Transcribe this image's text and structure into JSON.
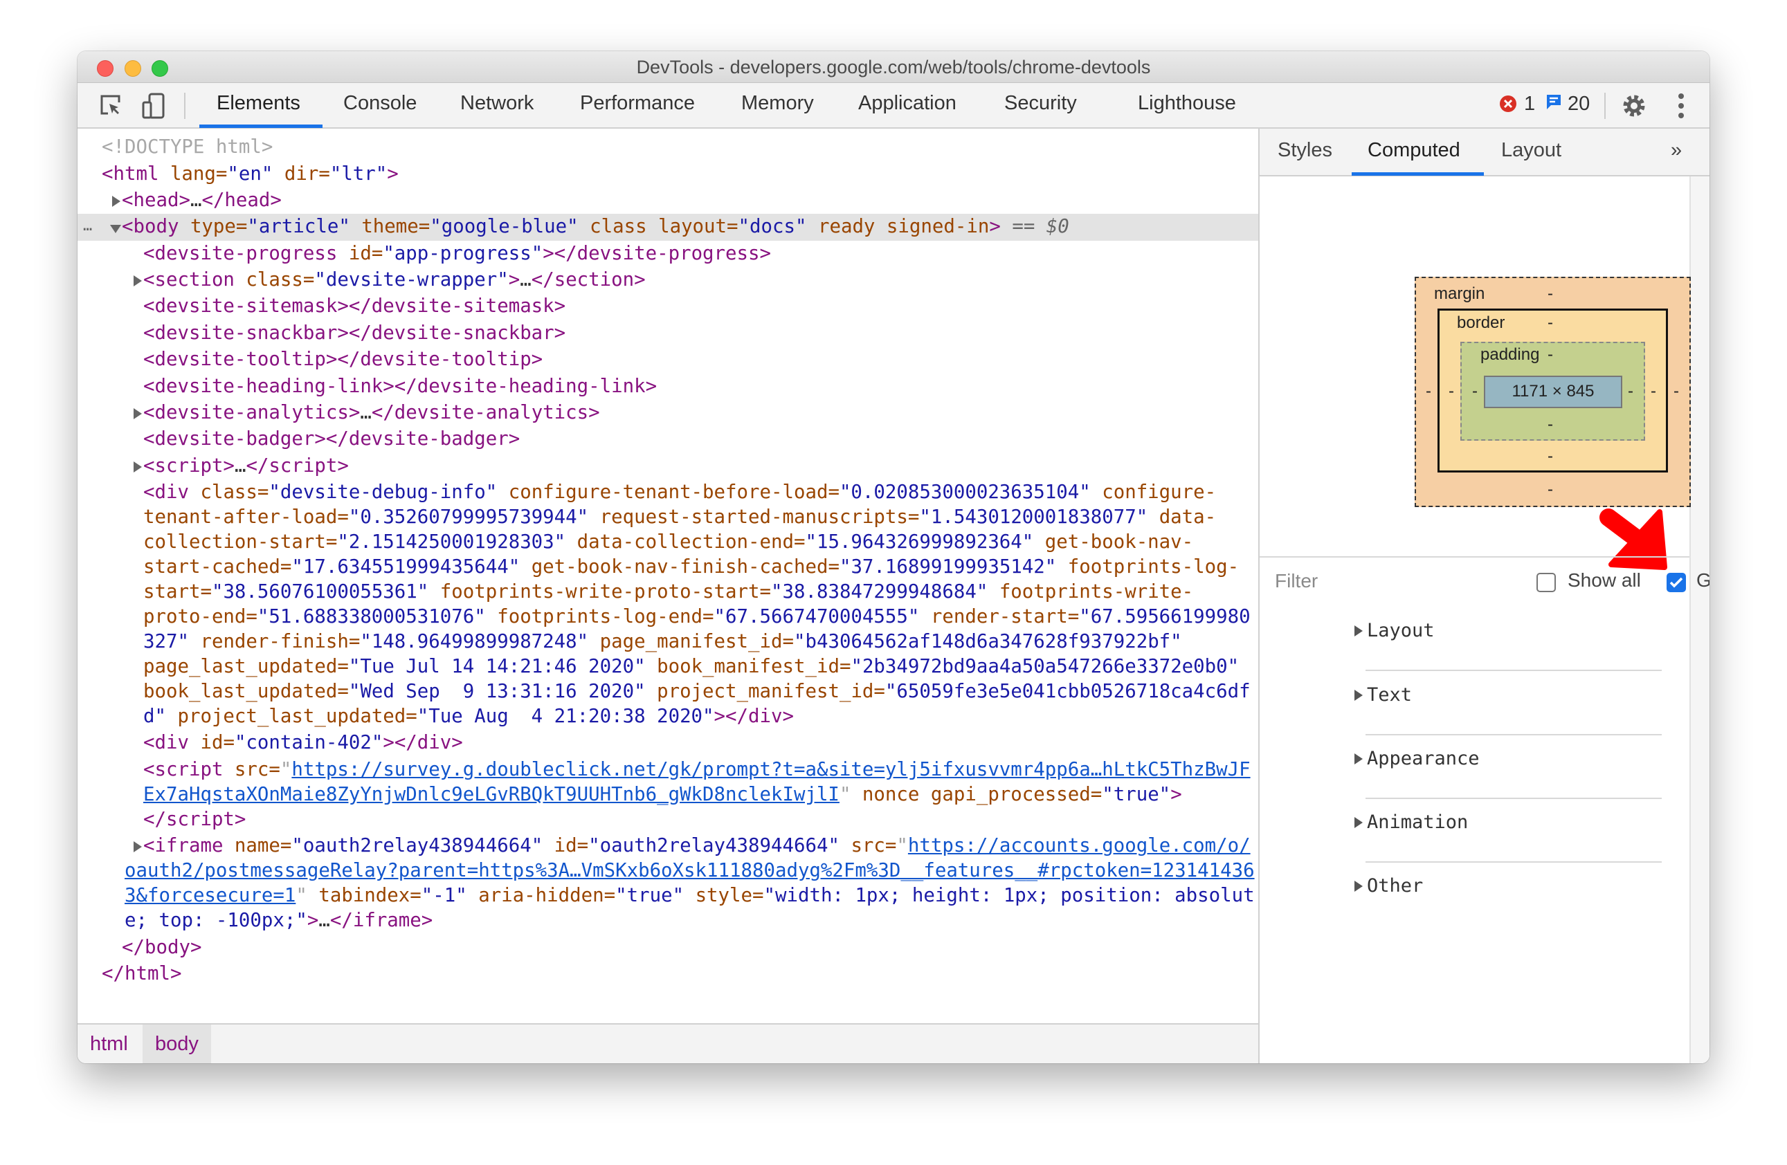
{
  "window": {
    "title": "DevTools - developers.google.com/web/tools/chrome-devtools"
  },
  "toolbar": {
    "tabs": [
      {
        "label": "Elements",
        "active": true
      },
      {
        "label": "Console"
      },
      {
        "label": "Network"
      },
      {
        "label": "Performance"
      },
      {
        "label": "Memory"
      },
      {
        "label": "Application"
      },
      {
        "label": "Security"
      },
      {
        "label": "Lighthouse"
      }
    ],
    "error_count": "1",
    "message_count": "20",
    "colors": {
      "accent": "#1a73e8",
      "error": "#d93025"
    }
  },
  "elements_panel": {
    "nodes": [
      {
        "depth": 0,
        "lines": [
          [
            [
              "d",
              "<!DOCTYPE html>"
            ]
          ]
        ]
      },
      {
        "depth": 0,
        "lines": [
          [
            [
              "t",
              "<html"
            ],
            [
              "a",
              " lang="
            ],
            [
              "v",
              "\"en\""
            ],
            [
              "a",
              " dir="
            ],
            [
              "v",
              "\"ltr\""
            ],
            [
              "t",
              ">"
            ]
          ]
        ]
      },
      {
        "depth": 1,
        "expander": "collapsed",
        "lines": [
          [
            [
              "t",
              "<head>"
            ],
            [
              "x",
              "…"
            ],
            [
              "t",
              "</head>"
            ]
          ]
        ]
      },
      {
        "depth": 1,
        "expander": "expanded",
        "selected": true,
        "lines": [
          [
            [
              "t",
              "<body"
            ],
            [
              "a",
              " type="
            ],
            [
              "v",
              "\"article\""
            ],
            [
              "a",
              " theme="
            ],
            [
              "v",
              "\"google-blue\""
            ],
            [
              "a",
              " class layout="
            ],
            [
              "v",
              "\"docs\""
            ],
            [
              "a",
              " ready signed-in"
            ],
            [
              "t",
              ">"
            ],
            [
              "o",
              " == $0"
            ]
          ]
        ]
      },
      {
        "depth": 2,
        "lines": [
          [
            [
              "t",
              "<devsite-progress"
            ],
            [
              "a",
              " id="
            ],
            [
              "v",
              "\"app-progress\""
            ],
            [
              "t",
              "></devsite-progress>"
            ]
          ]
        ]
      },
      {
        "depth": 2,
        "expander": "collapsed",
        "lines": [
          [
            [
              "t",
              "<section"
            ],
            [
              "a",
              " class="
            ],
            [
              "v",
              "\"devsite-wrapper\""
            ],
            [
              "t",
              ">"
            ],
            [
              "x",
              "…"
            ],
            [
              "t",
              "</section>"
            ]
          ]
        ]
      },
      {
        "depth": 2,
        "lines": [
          [
            [
              "t",
              "<devsite-sitemask></devsite-sitemask>"
            ]
          ]
        ]
      },
      {
        "depth": 2,
        "lines": [
          [
            [
              "t",
              "<devsite-snackbar></devsite-snackbar>"
            ]
          ]
        ]
      },
      {
        "depth": 2,
        "lines": [
          [
            [
              "t",
              "<devsite-tooltip></devsite-tooltip>"
            ]
          ]
        ]
      },
      {
        "depth": 2,
        "lines": [
          [
            [
              "t",
              "<devsite-heading-link></devsite-heading-link>"
            ]
          ]
        ]
      },
      {
        "depth": 2,
        "expander": "collapsed",
        "lines": [
          [
            [
              "t",
              "<devsite-analytics>"
            ],
            [
              "x",
              "…"
            ],
            [
              "t",
              "</devsite-analytics>"
            ]
          ]
        ]
      },
      {
        "depth": 2,
        "lines": [
          [
            [
              "t",
              "<devsite-badger></devsite-badger>"
            ]
          ]
        ]
      },
      {
        "depth": 2,
        "expander": "collapsed",
        "lines": [
          [
            [
              "t",
              "<script>"
            ],
            [
              "x",
              "…"
            ],
            [
              "t",
              "</script>"
            ]
          ]
        ]
      },
      {
        "depth": 2,
        "lines": [
          [
            [
              "t",
              "<div"
            ],
            [
              "a",
              " class="
            ],
            [
              "v",
              "\"devsite-debug-info\""
            ],
            [
              "a",
              " configure-tenant-before-load="
            ],
            [
              "v",
              "\"0.020853000023635104\""
            ],
            [
              "a",
              " configure-"
            ]
          ],
          [
            [
              "a",
              "tenant-after-load="
            ],
            [
              "v",
              "\"0.35260799995739944\""
            ],
            [
              "a",
              " request-started-manuscripts="
            ],
            [
              "v",
              "\"1.5430120001838077\""
            ],
            [
              "a",
              " data-"
            ]
          ],
          [
            [
              "a",
              "collection-start="
            ],
            [
              "v",
              "\"2.1514250001928303\""
            ],
            [
              "a",
              " data-collection-end="
            ],
            [
              "v",
              "\"15.964326999892364\""
            ],
            [
              "a",
              " get-book-nav-"
            ]
          ],
          [
            [
              "a",
              "start-cached="
            ],
            [
              "v",
              "\"17.634551999435644\""
            ],
            [
              "a",
              " get-book-nav-finish-cached="
            ],
            [
              "v",
              "\"37.16899199935142\""
            ],
            [
              "a",
              " footprints-log-"
            ]
          ],
          [
            [
              "a",
              "start="
            ],
            [
              "v",
              "\"38.56076100055361\""
            ],
            [
              "a",
              " footprints-write-proto-start="
            ],
            [
              "v",
              "\"38.83847299948684\""
            ],
            [
              "a",
              " footprints-write-"
            ]
          ],
          [
            [
              "a",
              "proto-end="
            ],
            [
              "v",
              "\"51.688338000531076\""
            ],
            [
              "a",
              " footprints-log-end="
            ],
            [
              "v",
              "\"67.5667470004555\""
            ],
            [
              "a",
              " render-start="
            ],
            [
              "v",
              "\"67.59566199980"
            ]
          ],
          [
            [
              "v",
              "327\""
            ],
            [
              "a",
              " render-finish="
            ],
            [
              "v",
              "\"148.96499899987248\""
            ],
            [
              "a",
              " page_manifest_id="
            ],
            [
              "v",
              "\"b43064562af148d6a347628f937922bf\""
            ]
          ],
          [
            [
              "a",
              "page_last_updated="
            ],
            [
              "v",
              "\"Tue Jul 14 14:21:46 2020\""
            ],
            [
              "a",
              " book_manifest_id="
            ],
            [
              "v",
              "\"2b34972bd9aa4a50a547266e3372e0b0\""
            ]
          ],
          [
            [
              "a",
              "book_last_updated="
            ],
            [
              "v",
              "\"Wed Sep  9 13:31:16 2020\""
            ],
            [
              "a",
              " project_manifest_id="
            ],
            [
              "v",
              "\"65059fe3e5e041cbb0526718ca4c6df"
            ]
          ],
          [
            [
              "v",
              "d\""
            ],
            [
              "a",
              " project_last_updated="
            ],
            [
              "v",
              "\"Tue Aug  4 21:20:38 2020\""
            ],
            [
              "t",
              "></div>"
            ]
          ]
        ]
      },
      {
        "depth": 2,
        "lines": [
          [
            [
              "t",
              "<div"
            ],
            [
              "a",
              " id="
            ],
            [
              "v",
              "\"contain-402\""
            ],
            [
              "t",
              "></div>"
            ]
          ]
        ]
      },
      {
        "depth": 2,
        "lines": [
          [
            [
              "t",
              "<script"
            ],
            [
              "a",
              " src="
            ],
            [
              "p",
              "\""
            ],
            [
              "l",
              "https://survey.g.doubleclick.net/gk/prompt?t=a&site=ylj5ifxusvvmr4pp6a…hLtkC5ThzBwJF"
            ]
          ],
          [
            [
              "l",
              "Ex7aHqstaXOnMaie8ZyYnjwDnlc9eLGvRBQkT9UUHTnb6_gWkD8nclekIwjlI"
            ],
            [
              "p",
              "\""
            ],
            [
              "a",
              " nonce gapi_processed="
            ],
            [
              "v",
              "\"true\""
            ],
            [
              "t",
              ">"
            ]
          ],
          [
            [
              "t",
              "</script>"
            ]
          ]
        ]
      },
      {
        "depth": 2,
        "expander": "collapsed",
        "lines": [
          [
            [
              "t",
              "<iframe"
            ],
            [
              "a",
              " name="
            ],
            [
              "v",
              "\"oauth2relay438944664\""
            ],
            [
              "a",
              " id="
            ],
            [
              "v",
              "\"oauth2relay438944664\""
            ],
            [
              "a",
              " src="
            ],
            [
              "p",
              "\""
            ],
            [
              "l",
              "https://accounts.google.com/o/"
            ]
          ],
          [
            [
              "l",
              "oauth2/postmessageRelay?parent=https%3A…VmSKxb6oXsk111880adyg%2Fm%3D__features__#rpctoken=123141436"
            ]
          ],
          [
            [
              "l",
              "3&forcesecure=1"
            ],
            [
              "p",
              "\""
            ],
            [
              "a",
              " tabindex="
            ],
            [
              "v",
              "\"-1\""
            ],
            [
              "a",
              " aria-hidden="
            ],
            [
              "v",
              "\"true\""
            ],
            [
              "a",
              " style="
            ],
            [
              "v",
              "\"width: 1px; height: 1px; position: absolut"
            ]
          ],
          [
            [
              "v",
              "e; top: -100px;\""
            ],
            [
              "t",
              ">"
            ],
            [
              "x",
              "…"
            ],
            [
              "t",
              "</iframe>"
            ]
          ]
        ]
      },
      {
        "depth": 1,
        "lines": [
          [
            [
              "t",
              "</body>"
            ]
          ]
        ]
      },
      {
        "depth": 0,
        "lines": [
          [
            [
              "t",
              "</html>"
            ]
          ]
        ]
      }
    ],
    "selected_marker": "…"
  },
  "breadcrumbs": [
    "html",
    "body"
  ],
  "sidebar": {
    "tabs": [
      {
        "label": "Styles"
      },
      {
        "label": "Computed",
        "active": true
      },
      {
        "label": "Layout"
      }
    ],
    "overflow_label": "»",
    "box_model": {
      "margin_label": "margin",
      "margin_top": "-",
      "margin_right": "-",
      "margin_bottom": "-",
      "margin_left": "-",
      "border_label": "border",
      "border_top": "-",
      "border_right": "-",
      "border_bottom": "-",
      "border_left": "-",
      "padding_label": "padding",
      "padding_top": "-",
      "padding_right": "-",
      "padding_bottom": "-",
      "padding_left": "-",
      "content_size": "1171 × 845",
      "colors": {
        "margin": "#f6cfa4",
        "border": "#fadca1",
        "padding": "#c4d08e",
        "content": "#96b6c2"
      }
    },
    "filter": {
      "placeholder": "Filter",
      "show_all_label": "Show all",
      "show_all_checked": false,
      "group_label": "Group",
      "group_checked": true
    },
    "sections": [
      "Layout",
      "Text",
      "Appearance",
      "Animation",
      "Other"
    ],
    "annotation": {
      "type": "red-arrow",
      "color": "#ff0000",
      "points_to": "Group"
    }
  }
}
